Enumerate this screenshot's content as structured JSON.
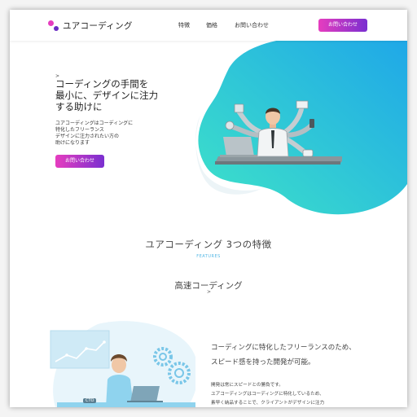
{
  "header": {
    "logo_text": "ユアコーディング",
    "nav": [
      "特徴",
      "価格",
      "お問い合わせ"
    ],
    "cta": "お問い合わせ"
  },
  "hero": {
    "arrow": ">",
    "title_lines": [
      "コーディングの手間を",
      "最小に、デザインに注力",
      "する助けに"
    ],
    "desc_lines": [
      "ユアコーディングはコーディングに",
      "特化したフリーランス",
      "デザインに注力されたい方の",
      "助けになります"
    ],
    "cta": "お問い合わせ"
  },
  "features": {
    "title": "ユアコーディング 3つの特徴",
    "subtitle": "FEATURES",
    "heading": "高速コーディング",
    "chevron": ">",
    "lead_lines": [
      "コーディングに特化したフリーランスのため、",
      "スピード感を持った開発が可能。"
    ],
    "body_lines": [
      "開発は常にスピードとの勝負です。",
      "ユアコーディングはコーディングに特化しているため、",
      "素早く納品することで、クライアントがデザインに注力"
    ],
    "badge": "CTO"
  },
  "colors": {
    "accent_pink": "#e63dbf",
    "accent_purple": "#7a2fd0",
    "blob_teal": "#3ee3c8",
    "blob_blue": "#1fa7e8",
    "features_label": "#57b9e6"
  }
}
